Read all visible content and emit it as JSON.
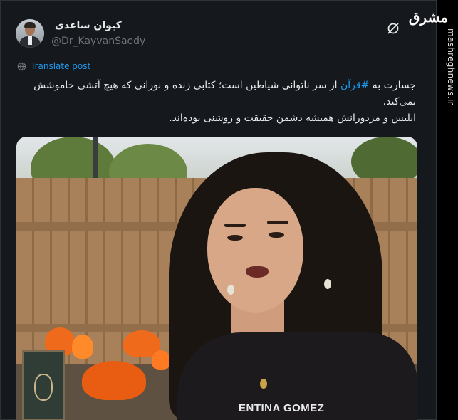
{
  "author": {
    "display_name": "کیوان ساعدی",
    "handle": "@Dr_KayvanSaedy"
  },
  "translate": {
    "label": "Translate post"
  },
  "tweet": {
    "text_before_hashtag": "جسارت به ",
    "hashtag": "#قرآن",
    "text_after_hashtag": " از سر ناتوانی شیاطین است؛ کتابی زنده و نورانی که هیچ آتشی خاموشش نمی‌کند.",
    "line_3": "ابلیس و مزدورانش همیشه دشمن حقیقت و روشنی بوده‌اند."
  },
  "media": {
    "shirt_text": "ENTINA GOMEZ"
  },
  "watermark": {
    "logo_text": "مشرق",
    "site": "mashreghnews.ir"
  },
  "colors": {
    "background": "#000000",
    "card": "#15181c",
    "accent": "#1d9bf0",
    "muted": "#71767b",
    "flame": "#f06a1b"
  },
  "icons": {
    "translate": "globe-icon",
    "grok": "grok-icon"
  }
}
